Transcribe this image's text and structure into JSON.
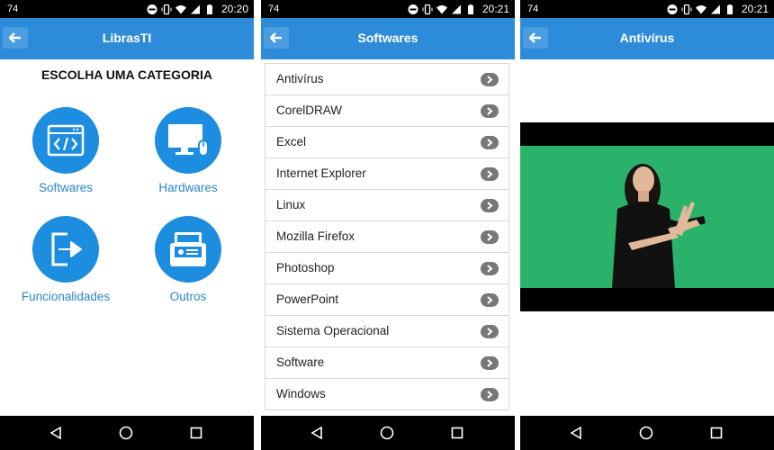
{
  "status": {
    "s1": {
      "left": "74",
      "time": "20:20"
    },
    "s2": {
      "left": "74",
      "time": "20:21"
    },
    "s3": {
      "left": "74",
      "time": "20:21"
    }
  },
  "screens": {
    "categories": {
      "title": "LibrasTI",
      "heading": "ESCOLHA UMA CATEGORIA",
      "items": [
        {
          "label": "Softwares",
          "icon": "code-window-icon"
        },
        {
          "label": "Hardwares",
          "icon": "desktop-computer-icon"
        },
        {
          "label": "Funcionalidades",
          "icon": "exit-arrow-icon"
        },
        {
          "label": "Outros",
          "icon": "card-box-icon"
        }
      ]
    },
    "softwares": {
      "title": "Softwares",
      "items": [
        "Antivírus",
        "CorelDRAW",
        "Excel",
        "Internet Explorer",
        "Linux",
        "Mozilla Firefox",
        "Photoshop",
        "PowerPoint",
        "Sistema Operacional",
        "Software",
        "Windows"
      ]
    },
    "video": {
      "title": "Antivírus"
    }
  },
  "colors": {
    "appbar": "#2d8cd9",
    "accent_circle": "#1d8de0",
    "label_blue": "#2a86c9",
    "video_green": "#2bb26a"
  }
}
